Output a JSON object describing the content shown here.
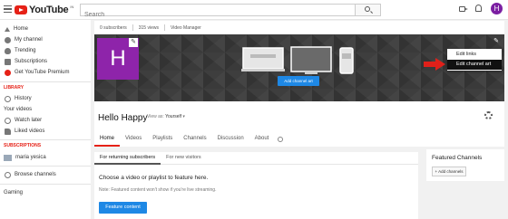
{
  "topbar": {
    "logo_text": "YouTube",
    "logo_sup": "IN",
    "search_placeholder": "Search",
    "avatar_letter": "H"
  },
  "sidebar": {
    "items": [
      {
        "label": "Home",
        "icon": "home-icon"
      },
      {
        "label": "My channel",
        "icon": "person-icon"
      },
      {
        "label": "Trending",
        "icon": "fire-icon"
      },
      {
        "label": "Subscriptions",
        "icon": "subscriptions-icon"
      },
      {
        "label": "Get YouTube Premium",
        "icon": "youtube-premium-icon"
      }
    ],
    "library_title": "LIBRARY",
    "library_items": [
      {
        "label": "History",
        "icon": "history-icon"
      },
      {
        "label": "Your videos",
        "icon": ""
      },
      {
        "label": "Watch later",
        "icon": "clock-icon"
      },
      {
        "label": "Liked videos",
        "icon": "thumb-up-icon"
      }
    ],
    "subscriptions_title": "SUBSCRIPTIONS",
    "subscriptions": [
      {
        "label": "maria yesica"
      }
    ],
    "browse_channels": "Browse channels",
    "gaming": "Gaming"
  },
  "stats": {
    "subscribers": "0 subscribers",
    "views": "315 views",
    "video_manager": "Video Manager"
  },
  "banner": {
    "avatar_letter": "H",
    "add_channel_art": "Add channel art",
    "menu": [
      "Edit links",
      "Edit channel art"
    ]
  },
  "channel": {
    "name": "Hello Happy",
    "view_as_label": "View as:",
    "view_as_value": "Yourself",
    "tabs": [
      "Home",
      "Videos",
      "Playlists",
      "Channels",
      "Discussion",
      "About"
    ]
  },
  "content": {
    "subtabs": [
      "For returning subscribers",
      "For new visitors"
    ],
    "prompt": "Choose a video or playlist to feature here.",
    "note": "Note: Featured content won't show if you're live streaming.",
    "feature_button": "Feature content"
  },
  "featured_channels": {
    "title": "Featured Channels",
    "add_button": "+ Add channels"
  },
  "colors": {
    "accent_red": "#e62117",
    "brand_blue": "#1e88e5",
    "avatar_purple": "#8e24aa"
  }
}
